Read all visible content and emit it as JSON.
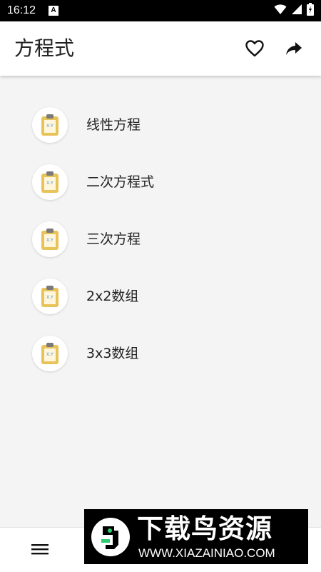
{
  "status_bar": {
    "time": "16:12",
    "notification_icon": "a-notification-icon",
    "icons": [
      "wifi-icon",
      "signal-icon",
      "battery-icon"
    ]
  },
  "app_bar": {
    "title": "方程式",
    "favorite_icon": "heart-outline-icon",
    "share_icon": "share-arrow-icon"
  },
  "equations": [
    {
      "label": "线性方程",
      "icon": "clipboard-xy-icon"
    },
    {
      "label": "二次方程式",
      "icon": "clipboard-xy-icon"
    },
    {
      "label": "三次方程",
      "icon": "clipboard-xy-icon"
    },
    {
      "label": "2x2数组",
      "icon": "clipboard-xy-icon"
    },
    {
      "label": "3x3数组",
      "icon": "clipboard-xy-icon"
    }
  ],
  "bottom_bar": {
    "menu_icon": "hamburger-menu-icon"
  },
  "watermark": {
    "title": "下载鸟资源",
    "url": "WWW.XIAZAINIAO.COM"
  },
  "colors": {
    "status_bar": "#000000",
    "app_bar": "#ffffff",
    "background": "#f4f4f4",
    "clipboard": "#e8c35a",
    "clipboard_clip": "#7a7a7a",
    "watermark_bg": "#000000",
    "watermark_accent": "#2ecc71"
  }
}
